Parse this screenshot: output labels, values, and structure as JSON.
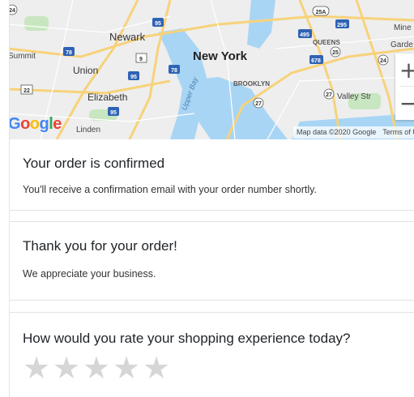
{
  "map": {
    "labels": {
      "newark": "Newark",
      "new_york": "New York",
      "union": "Union",
      "summit": "Summit",
      "elizabeth": "Elizabeth",
      "brooklyn": "BROOKLYN",
      "queens": "QUEENS",
      "valley_stream": "Valley Str",
      "linden": "Linden",
      "upper_bay": "Upper Bay",
      "mineola": "Mine",
      "garden": "Garde"
    },
    "shields": [
      "24",
      "95",
      "78",
      "9",
      "78",
      "95",
      "22",
      "95",
      "495",
      "295",
      "25A",
      "678",
      "25",
      "27",
      "27",
      "24"
    ],
    "zoom_in": "+",
    "zoom_out": "−",
    "logo": {
      "g1": "G",
      "g2": "o",
      "g3": "o",
      "g4": "g",
      "g5": "l",
      "g6": "e"
    },
    "attribution": "Map data ©2020 Google",
    "terms": "Terms of Us"
  },
  "confirmation": {
    "title": "Your order is confirmed",
    "message": "You'll receive a confirmation email with your order number shortly."
  },
  "thanks": {
    "title": "Thank you for your order!",
    "message": "We appreciate your business."
  },
  "rating": {
    "question": "How would you rate your shopping experience today?",
    "stars": [
      "★",
      "★",
      "★",
      "★",
      "★"
    ],
    "value": 0,
    "max": 5
  }
}
